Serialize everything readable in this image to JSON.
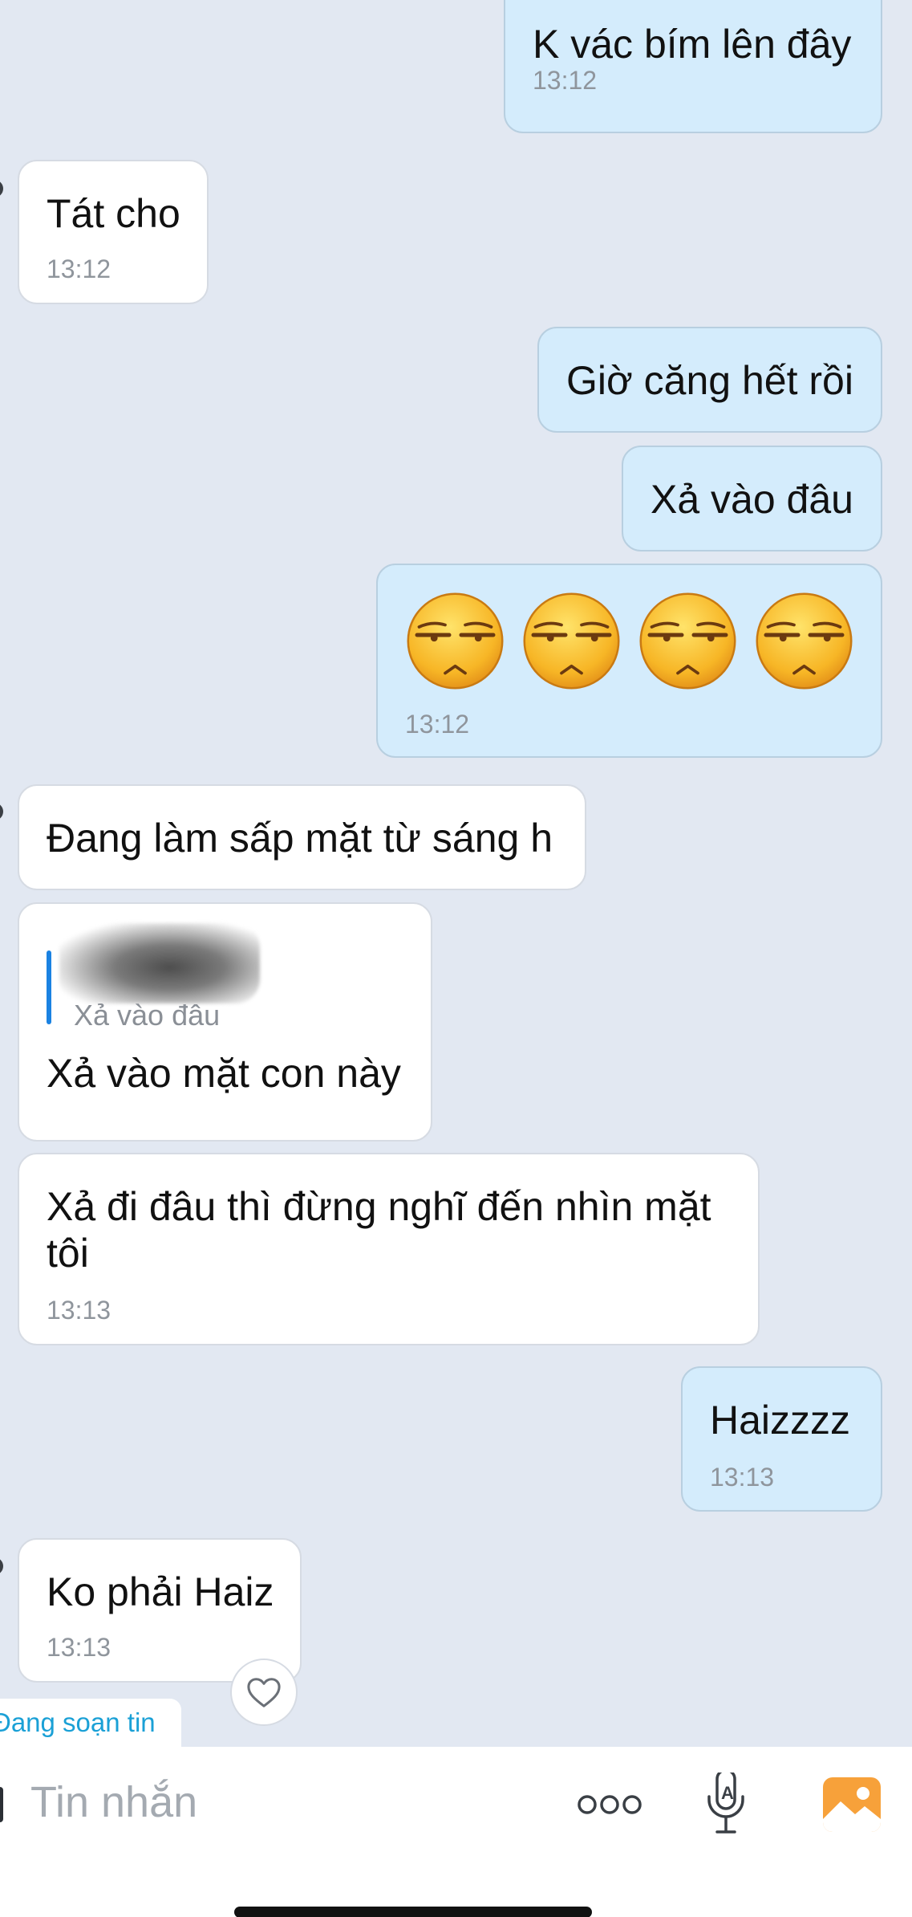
{
  "messages": [
    {
      "side": "out",
      "text": "K vác bím lên đây",
      "time": "13:12"
    },
    {
      "side": "in",
      "text": "Tát cho",
      "time": "13:12"
    },
    {
      "side": "out",
      "text": "Giờ căng hết rồi"
    },
    {
      "side": "out",
      "text": "Xả vào đâu"
    },
    {
      "side": "out",
      "emoji_count": 4,
      "emoji": "unamused-face",
      "time": "13:12"
    },
    {
      "side": "in",
      "text": "Đang làm sấp mặt từ sáng h"
    },
    {
      "side": "in",
      "quote": "Xả vào đâu",
      "text": "Xả vào mặt con này"
    },
    {
      "side": "in",
      "text": "Xả đi đâu thì đừng nghĩ đến nhìn mặt tôi",
      "time": "13:13"
    },
    {
      "side": "out",
      "text": "Haizzzz",
      "time": "13:13"
    },
    {
      "side": "in",
      "text": "Ko phải Haiz",
      "time": "13:13"
    }
  ],
  "reaction": {
    "icon": "heart-outline-icon"
  },
  "typing_indicator": "Đang soạn tin",
  "composer": {
    "placeholder": "Tin nhắn",
    "icons": [
      "more-icon",
      "voice-to-text-icon",
      "gallery-icon"
    ]
  },
  "colors": {
    "background": "#e2e8f2",
    "incoming_bubble": "#ffffff",
    "outgoing_bubble": "#d4ecfc",
    "timestamp": "#8f959c",
    "accent_blue": "#1aa0d6",
    "gallery_orange": "#f7a13a"
  }
}
